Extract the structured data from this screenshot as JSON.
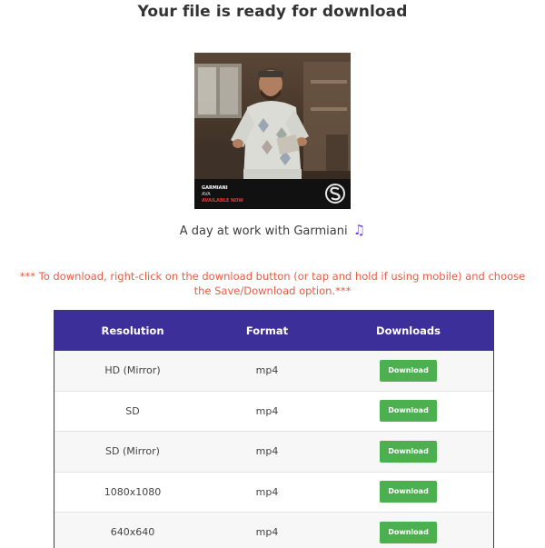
{
  "page": {
    "title": "Your file is ready for download"
  },
  "media": {
    "overlay_artist": "GARMIANI",
    "overlay_track": "AVA",
    "overlay_status": "AVAILABLE NOW",
    "caption": "A day at work with Garmiani",
    "caption_icon": "music-note-icon"
  },
  "notice": "*** To download, right-click on the download button (or tap and hold if using mobile) and choose the Save/Download option.***",
  "table": {
    "headers": {
      "resolution": "Resolution",
      "format": "Format",
      "downloads": "Downloads"
    },
    "rows": [
      {
        "resolution": "HD (Mirror)",
        "format": "mp4",
        "button": "Download"
      },
      {
        "resolution": "SD",
        "format": "mp4",
        "button": "Download"
      },
      {
        "resolution": "SD (Mirror)",
        "format": "mp4",
        "button": "Download"
      },
      {
        "resolution": "1080x1080",
        "format": "mp4",
        "button": "Download"
      },
      {
        "resolution": "640x640",
        "format": "mp4",
        "button": "Download"
      }
    ]
  },
  "colors": {
    "header_bg": "#3d2f99",
    "button_bg": "#4caf50",
    "notice_text": "#e85b43"
  }
}
